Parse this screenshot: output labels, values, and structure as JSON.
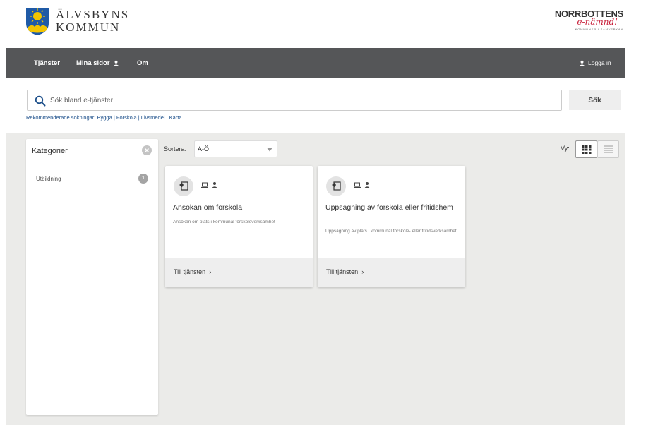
{
  "header": {
    "logo_line1": "ÄLVSBYNS",
    "logo_line2": "KOMMUN",
    "partner_line1": "NORRBOTTENS",
    "partner_line2": "e-nämnd!",
    "partner_line3": "KOMMUNER I SAMVERKAN"
  },
  "nav": {
    "items": [
      {
        "label": "Tjänster"
      },
      {
        "label": "Mina sidor"
      },
      {
        "label": "Om"
      }
    ],
    "login_label": "Logga in"
  },
  "search": {
    "placeholder": "Sök bland e-tjänster",
    "value": "",
    "button_label": "Sök",
    "recommended_prefix": "Rekommenderade sökningar:",
    "recommended": [
      "Bygga",
      "Förskola",
      "Livsmedel",
      "Karta"
    ]
  },
  "sidebar": {
    "title": "Kategorier",
    "categories": [
      {
        "label": "Utbildning",
        "count": "1"
      }
    ]
  },
  "sort": {
    "label": "Sortera:",
    "value": "A-Ö"
  },
  "view": {
    "label": "Vy:"
  },
  "cards": [
    {
      "title": "Ansökan om förskola",
      "description": "Ansökan om plats i kommunal förskoleverksamhet",
      "link_label": "Till tjänsten"
    },
    {
      "title": "Uppsägning av förskola eller fritidshem",
      "description": "Uppsägning av plats i kommunal förskole- eller fritidsverksamhet",
      "link_label": "Till tjänsten"
    }
  ],
  "colors": {
    "navbar": "#555658",
    "main_bg": "#ebebe9",
    "link": "#1c4f8a",
    "brand_red": "#c8203a"
  }
}
